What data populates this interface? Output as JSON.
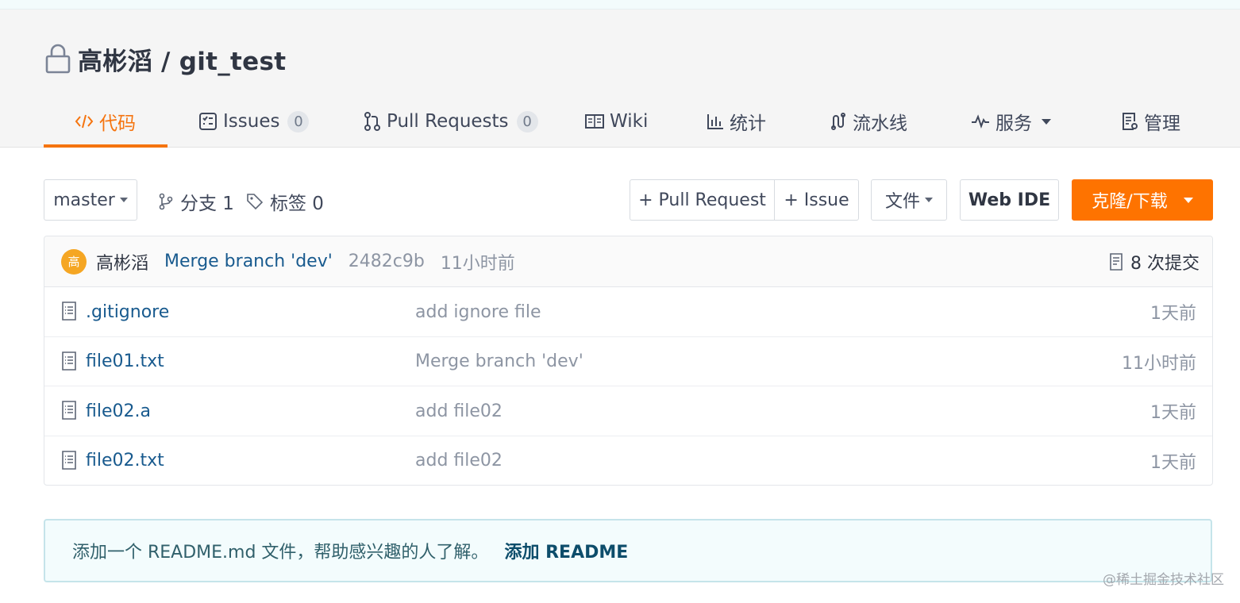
{
  "repo": {
    "title": "高彬滔 / git_test"
  },
  "tabs": [
    {
      "label": "代码",
      "icon": "code-icon",
      "active": true
    },
    {
      "label": "Issues",
      "icon": "issues-icon",
      "count": "0"
    },
    {
      "label": "Pull Requests",
      "icon": "pull-request-icon",
      "count": "0"
    },
    {
      "label": "Wiki",
      "icon": "book-icon"
    },
    {
      "label": "统计",
      "icon": "bar-chart-icon"
    },
    {
      "label": "流水线",
      "icon": "pipeline-icon"
    },
    {
      "label": "服务",
      "icon": "pulse-icon",
      "dropdown": true
    },
    {
      "label": "管理",
      "icon": "manage-icon"
    }
  ],
  "toolbar": {
    "branch": "master",
    "branches_label": "分支 1",
    "tags_label": "标签 0",
    "pull_request_btn": "+ Pull Request",
    "issue_btn": "+ Issue",
    "file_btn": "文件",
    "webide_btn": "Web IDE",
    "clone_btn": "克隆/下载"
  },
  "latest_commit": {
    "avatar_letter": "高",
    "author": "高彬滔",
    "message": "Merge branch 'dev'",
    "hash": "2482c9b",
    "time": "11小时前",
    "count_label": "8 次提交"
  },
  "files": [
    {
      "name": ".gitignore",
      "message": "add ignore file",
      "time": "1天前"
    },
    {
      "name": "file01.txt",
      "message": "Merge branch 'dev'",
      "time": "11小时前"
    },
    {
      "name": "file02.a",
      "message": "add file02",
      "time": "1天前"
    },
    {
      "name": "file02.txt",
      "message": "add file02",
      "time": "1天前"
    }
  ],
  "readme_notice": {
    "text": "添加一个 README.md 文件，帮助感兴趣的人了解。",
    "link": "添加 README"
  },
  "watermark": "@稀土掘金技术社区",
  "colors": {
    "accent": "#f5740f",
    "link": "#185a8e",
    "muted": "#8d95a3"
  }
}
